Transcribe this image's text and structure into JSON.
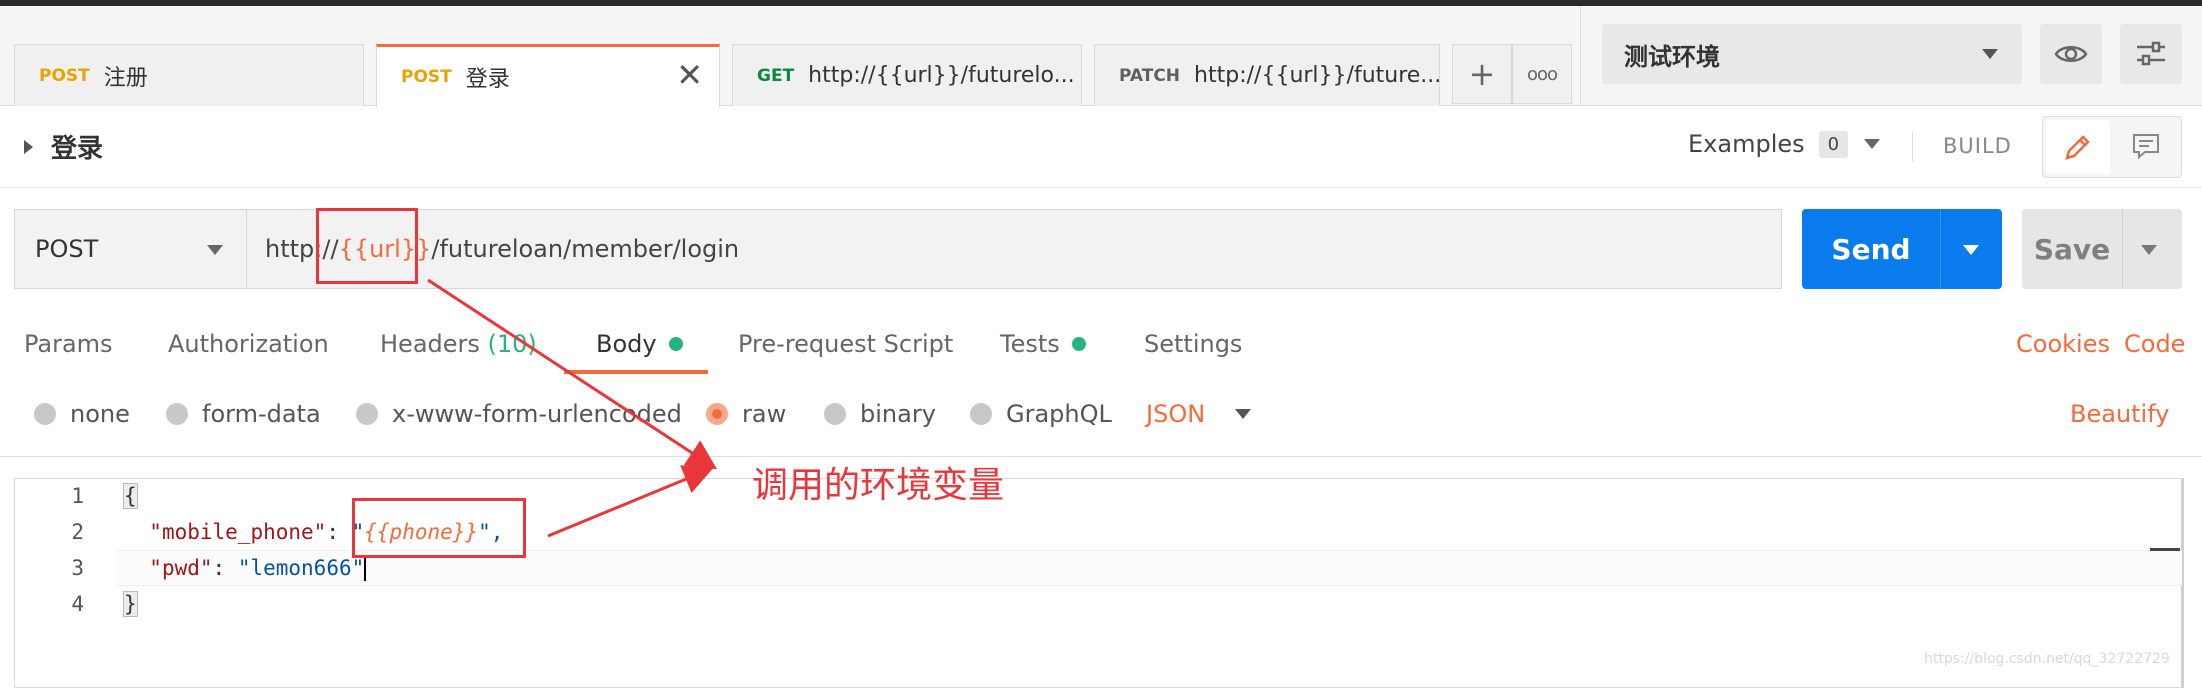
{
  "tabs": [
    {
      "method": "POST",
      "label": "注册",
      "active": false
    },
    {
      "method": "POST",
      "label": "登录",
      "active": true,
      "close": "✕"
    },
    {
      "method": "GET",
      "label": "http://{{url}}/futurelo...",
      "active": false
    },
    {
      "method": "PATCH",
      "label": "http://{{url}}/future...",
      "active": false
    }
  ],
  "tab_actions": {
    "add": "+",
    "more": "ooo"
  },
  "environment": {
    "selected": "测试环境",
    "eye_icon": "eye-icon",
    "settings_icon": "sliders-icon"
  },
  "request": {
    "title": "登录",
    "examples_label": "Examples",
    "examples_count": "0",
    "build_label": "BUILD",
    "method": "POST",
    "url_prefix": "http://",
    "url_var": "{{url}}",
    "url_suffix": "/futureloan/member/login",
    "send_label": "Send",
    "save_label": "Save"
  },
  "subtabs": {
    "params": "Params",
    "authorization": "Authorization",
    "headers": "Headers",
    "headers_count": "(10)",
    "body": "Body",
    "prerequest": "Pre-request Script",
    "tests": "Tests",
    "settings": "Settings",
    "cookies": "Cookies",
    "code": "Code"
  },
  "body_types": {
    "none": "none",
    "form_data": "form-data",
    "urlencoded": "x-www-form-urlencoded",
    "raw": "raw",
    "binary": "binary",
    "graphql": "GraphQL",
    "format": "JSON",
    "beautify": "Beautify"
  },
  "editor": {
    "line_numbers": [
      "1",
      "2",
      "3",
      "4"
    ],
    "open_brace": "{",
    "key_phone": "\"mobile_phone\"",
    "colon_sep": ": ",
    "quote_open": "\"",
    "phone_var": "{{phone}}",
    "quote_close_comma": "\",",
    "key_pwd": "\"pwd\"",
    "pwd_value": "\"lemon666\"",
    "close_brace": "}"
  },
  "annotation": {
    "text": "调用的环境变量",
    "color": "#e8363a"
  },
  "watermark": "https://blog.csdn.net/qq_32722729",
  "colors": {
    "accent": "#f26b3a",
    "send": "#097bed",
    "status_dot": "#26b47f",
    "annotation": "#e8363a"
  }
}
